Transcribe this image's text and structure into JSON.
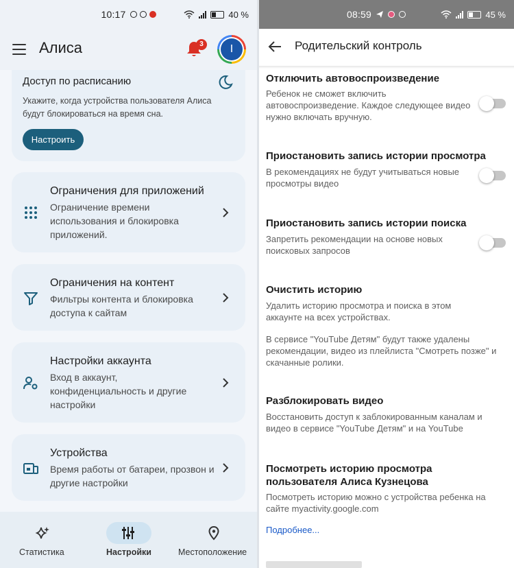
{
  "left": {
    "status": {
      "time": "10:17",
      "battery": "40 %"
    },
    "appbar": {
      "title": "Алиса",
      "notification_count": "3",
      "avatar_letter": "I"
    },
    "schedule": {
      "title": "Доступ по расписанию",
      "description": "Укажите, когда устройства пользователя Алиса будут блокироваться на время сна.",
      "button": "Настроить"
    },
    "cards": [
      {
        "title": "Ограничения для приложений",
        "desc": "Ограничение времени использования и блокировка приложений.",
        "icon": "apps-grid-icon"
      },
      {
        "title": "Ограничения на контент",
        "desc": "Фильтры контента и блокировка доступа к сайтам",
        "icon": "filter-icon"
      },
      {
        "title": "Настройки аккаунта",
        "desc": "Вход в аккаунт, конфиденциальность и другие настройки",
        "icon": "account-settings-icon"
      },
      {
        "title": "Устройства",
        "desc": "Время работы от батареи, прозвон и другие настройки",
        "icon": "devices-icon"
      }
    ],
    "nav": [
      {
        "label": "Статистика",
        "icon": "sparkle-icon",
        "active": false
      },
      {
        "label": "Настройки",
        "icon": "sliders-icon",
        "active": true
      },
      {
        "label": "Местоположение",
        "icon": "location-pin-icon",
        "active": false
      }
    ]
  },
  "right": {
    "status": {
      "time": "08:59",
      "battery": "45 %"
    },
    "header": {
      "title": "Родительский контроль"
    },
    "sections": [
      {
        "title": "Отключить автовоспроизведение",
        "desc": "Ребенок не сможет включить автовоспроизведение. Каждое следующее видео нужно включать вручную.",
        "toggle": false
      },
      {
        "title": "Приостановить запись истории просмотра",
        "desc": "В рекомендациях не будут учитываться новые просмотры видео",
        "toggle": false
      },
      {
        "title": "Приостановить запись истории поиска",
        "desc": "Запретить рекомендации на основе новых поисковых запросов",
        "toggle": false
      },
      {
        "title": "Очистить историю",
        "desc": "Удалить историю просмотра и поиска в этом аккаунте на всех устройствах.",
        "desc2": "В сервисе \"YouTube Детям\" будут также удалены рекомендации, видео из плейлиста \"Смотреть позже\" и скачанные ролики."
      },
      {
        "title": "Разблокировать видео",
        "desc": "Восстановить доступ к заблокированным каналам и видео в сервисе \"YouTube Детям\" и на YouTube"
      },
      {
        "title": "Посмотреть историю просмотра пользователя Алиса Кузнецова",
        "desc": "Посмотреть историю можно с устройства ребенка на сайте myactivity.google.com"
      }
    ],
    "more_link": "Подробнее..."
  },
  "colors": {
    "accent": "#1c5f7c",
    "notification": "#d93025",
    "link": "#1a5ac8"
  }
}
